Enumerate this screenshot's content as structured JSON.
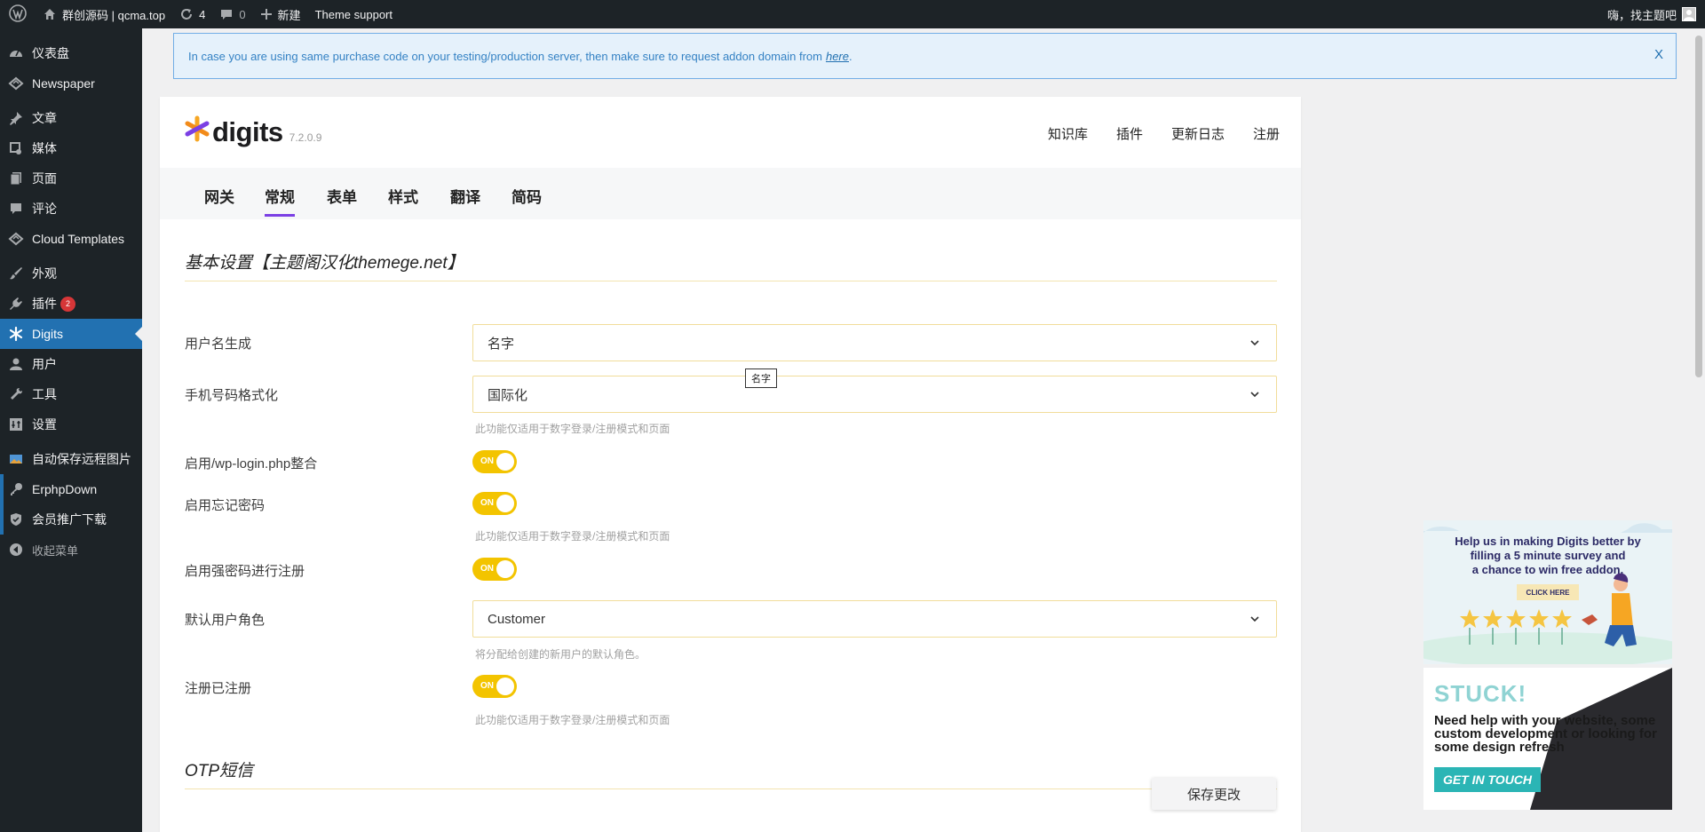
{
  "adminbar": {
    "site_name": "群创源码 | qcma.top",
    "updates_count": "4",
    "comments_count": "0",
    "new_label": "新建",
    "theme_support": "Theme support",
    "greeting": "嗨，找主题吧"
  },
  "sidebar": {
    "items": [
      {
        "label": "仪表盘",
        "icon": "dashboard-icon"
      },
      {
        "label": "Newspaper",
        "icon": "newspaper-icon"
      },
      {
        "label": "文章",
        "icon": "pin-icon"
      },
      {
        "label": "媒体",
        "icon": "media-icon"
      },
      {
        "label": "页面",
        "icon": "page-icon"
      },
      {
        "label": "评论",
        "icon": "comment-icon"
      },
      {
        "label": "Cloud Templates",
        "icon": "cloud-templates-icon"
      },
      {
        "label": "外观",
        "icon": "brush-icon"
      },
      {
        "label": "插件",
        "icon": "plugin-icon",
        "badge": "2"
      },
      {
        "label": "Digits",
        "icon": "digits-icon"
      },
      {
        "label": "用户",
        "icon": "user-icon"
      },
      {
        "label": "工具",
        "icon": "wrench-icon"
      },
      {
        "label": "设置",
        "icon": "settings-icon"
      },
      {
        "label": "自动保存远程图片",
        "icon": "image-icon"
      },
      {
        "label": "ErphpDown",
        "icon": "key-icon"
      },
      {
        "label": "会员推广下载",
        "icon": "shield-icon"
      },
      {
        "label": "收起菜单",
        "icon": "collapse-icon"
      }
    ]
  },
  "notice": {
    "text": "In case you are using same purchase code on your testing/production server, then make sure to request addon domain from",
    "link": "here",
    "tail": ".",
    "close": "X"
  },
  "header": {
    "logo_text": "digits",
    "version": "7.2.0.9",
    "links": [
      "知识库",
      "插件",
      "更新日志",
      "注册"
    ]
  },
  "tabs": [
    "网关",
    "常规",
    "表单",
    "样式",
    "翻译",
    "简码"
  ],
  "active_tab": "常规",
  "section_basic": "基本设置【主题阁汉化themege.net】",
  "settings": {
    "username_gen": {
      "label": "用户名生成",
      "value": "名字"
    },
    "phone_format": {
      "label": "手机号码格式化",
      "value": "国际化",
      "hint": "此功能仅适用于数字登录/注册模式和页面"
    },
    "wp_login": {
      "label": "启用/wp-login.php整合",
      "toggle": "ON"
    },
    "forgot_pw": {
      "label": "启用忘记密码",
      "toggle": "ON",
      "hint": "此功能仅适用于数字登录/注册模式和页面"
    },
    "strong_pw": {
      "label": "启用强密码进行注册",
      "toggle": "ON"
    },
    "default_role": {
      "label": "默认用户角色",
      "value": "Customer",
      "hint": "将分配给创建的新用户的默认角色。"
    },
    "reg_registered": {
      "label": "注册已注册",
      "toggle": "ON",
      "hint": "此功能仅适用于数字登录/注册模式和页面"
    }
  },
  "tooltip": "名字",
  "section_otp": "OTP短信",
  "save_button": "保存更改",
  "survey": {
    "line1": "Help us in making Digits better by",
    "line2": "filling a 5 minute survey and",
    "line3": "a chance to win free addon.",
    "button": "CLICK HERE"
  },
  "stuck": {
    "title": "STUCK!",
    "body": "Need help with your website, some custom development or looking for some design refresh",
    "button": "GET IN TOUCH"
  }
}
